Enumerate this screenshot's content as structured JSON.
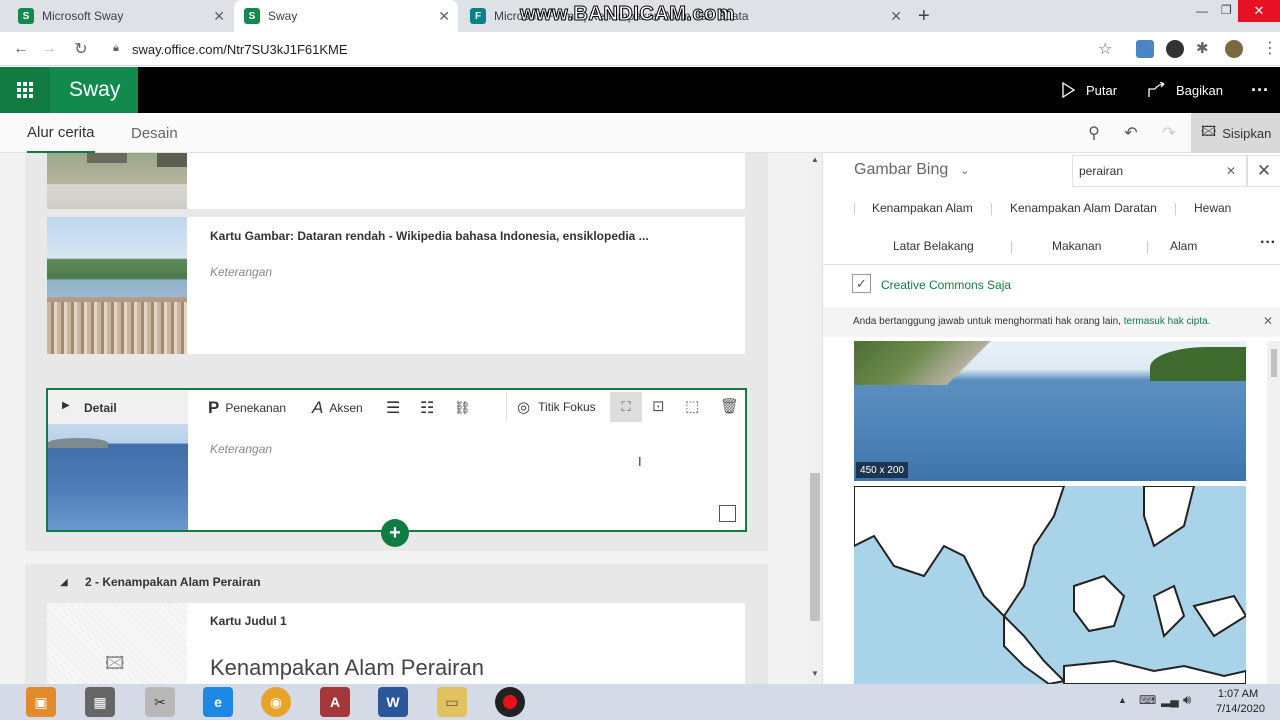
{
  "browser": {
    "tabs": [
      {
        "title": "Microsoft Sway",
        "favicon": "sway-icon",
        "active": false
      },
      {
        "title": "Sway",
        "favicon": "sway-icon",
        "active": true
      },
      {
        "title": "Microsoft Forms | Kenampakan Alam dan Buata",
        "favicon": "forms-icon",
        "active": false
      }
    ],
    "url": "sway.office.com/Ntr7SU3kJ1F61KME",
    "watermark": "www.BANDICAM.com"
  },
  "header": {
    "app_name": "Sway",
    "play_label": "Putar",
    "share_label": "Bagikan"
  },
  "sway_tabs": {
    "storyline": "Alur cerita",
    "design": "Desain",
    "insert": "Sisipkan"
  },
  "storyline": {
    "card2": {
      "title": "Kartu Gambar: Dataran rendah - Wikipedia bahasa Indonesia, ensiklopedia ...",
      "caption": "Keterangan"
    },
    "active_card": {
      "detail_label": "Detail",
      "toolbar": {
        "emphasis": "Penekanan",
        "accent": "Aksen",
        "focus": "Titik Fokus"
      },
      "caption": "Keterangan"
    },
    "section": {
      "title": "2 - Kenampakan Alam Perairan",
      "card_label": "Kartu Judul 1",
      "heading": "Kenampakan Alam Perairan"
    }
  },
  "right_panel": {
    "source": "Gambar Bing",
    "search_value": "perairan",
    "categories_row1": [
      "Kenampakan Alam",
      "Kenampakan Alam Daratan",
      "Hewan"
    ],
    "categories_row2": [
      "Latar Belakang",
      "Makanan",
      "Alam"
    ],
    "cc_label": "Creative Commons Saja",
    "notice_text": "Anda bertanggung jawab untuk menghormati hak orang lain,",
    "notice_link": "termasuk hak cipta.",
    "image1_size": "450 x 200"
  },
  "taskbar": {
    "time": "1:07 AM",
    "date": "7/14/2020"
  }
}
